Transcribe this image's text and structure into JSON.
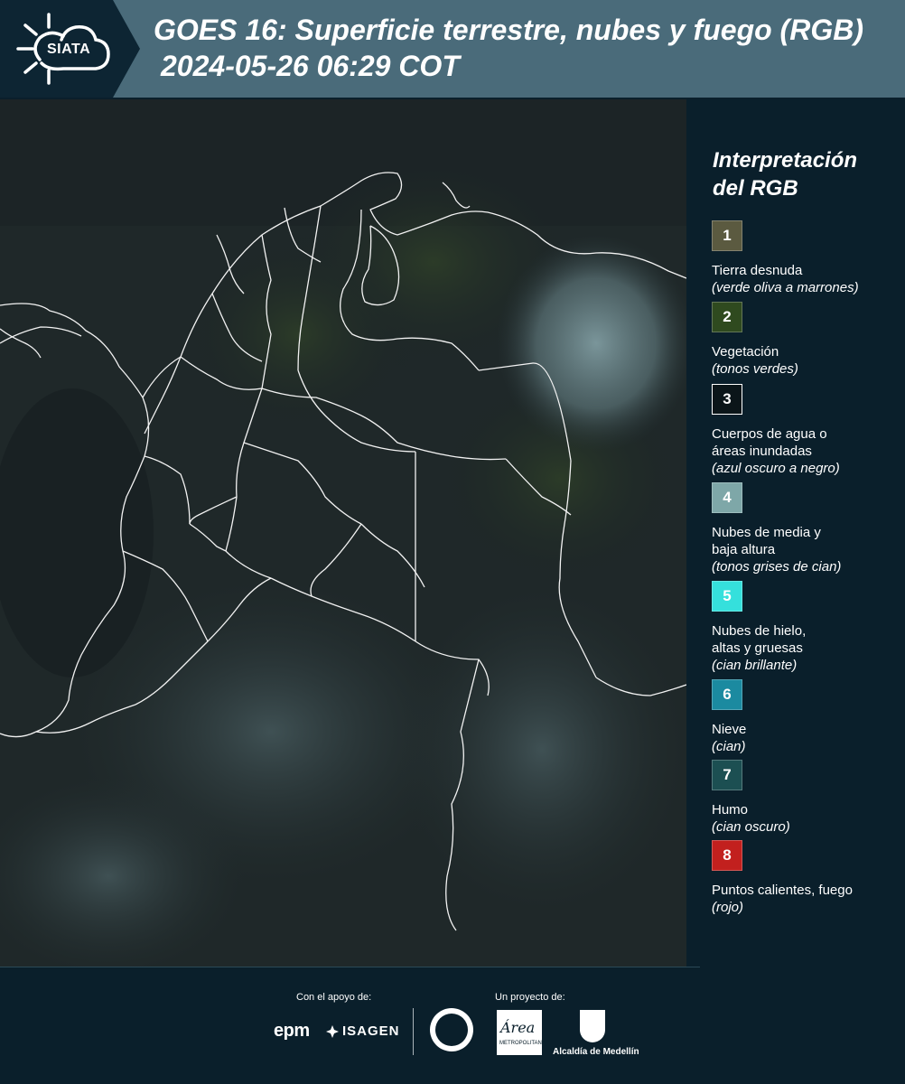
{
  "header": {
    "logo_text": "SIATA",
    "title": "GOES 16: Superficie terrestre, nubes y fuego (RGB)",
    "subtitle": "2024-05-26 06:29 COT"
  },
  "colors": {
    "header_bg": "#4a6b7a",
    "panel_bg": "#0a1f2b",
    "logo_bg": "#0d2533"
  },
  "legend": {
    "title": "Interpretación del RGB",
    "items": [
      {
        "number": "1",
        "color": "#5b5a40",
        "label": "Tierra desnuda",
        "desc": "(verde oliva a marrones)"
      },
      {
        "number": "2",
        "color": "#2f4a1f",
        "label": "Vegetación",
        "desc": "(tonos verdes)"
      },
      {
        "number": "3",
        "color": "#0b1519",
        "label": "Cuerpos de agua o áreas inundadas",
        "desc": "(azul oscuro a negro)"
      },
      {
        "number": "4",
        "color": "#7ea7a8",
        "label": "Nubes de media y baja altura",
        "desc": "(tonos grises de cian)"
      },
      {
        "number": "5",
        "color": "#35e0dc",
        "label": "Nubes de hielo, altas y gruesas",
        "desc": "(cian brillante)"
      },
      {
        "number": "6",
        "color": "#1b8aa0",
        "label": "Nieve",
        "desc": "(cian)"
      },
      {
        "number": "7",
        "color": "#1c4f52",
        "label": "Humo",
        "desc": "(cian oscuro)"
      },
      {
        "number": "8",
        "color": "#c2201e",
        "label": "Puntos calientes, fuego",
        "desc": "(rojo)"
      }
    ]
  },
  "footer": {
    "support_label": "Con el apoyo de:",
    "project_label": "Un proyecto de:",
    "epm": "epm",
    "isagen": "ISAGEN",
    "area_text": "Área",
    "area_sub": "METROPOLITANA",
    "alcaldia": "Alcaldía de Medellín"
  }
}
